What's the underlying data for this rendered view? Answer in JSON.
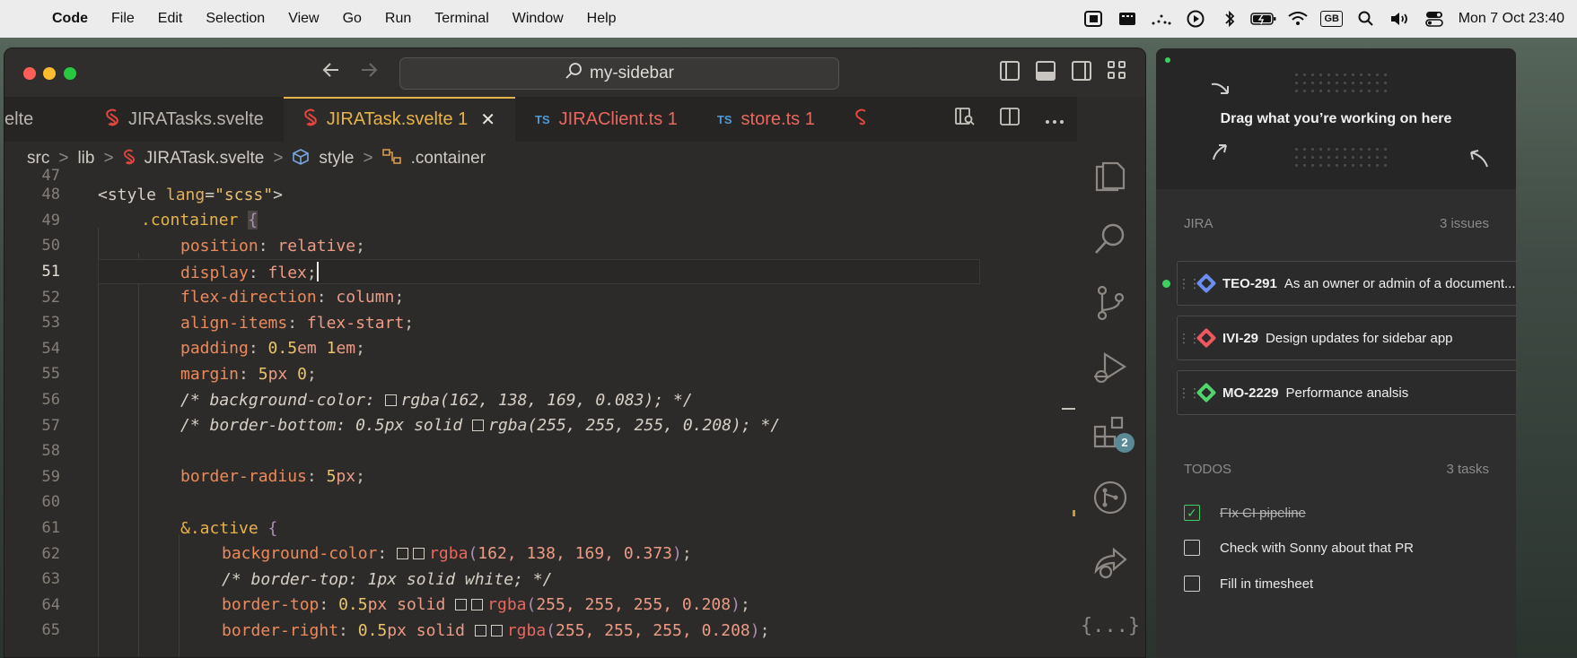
{
  "menubar": {
    "apple": "",
    "app_name": "Code",
    "menus": [
      "File",
      "Edit",
      "Selection",
      "View",
      "Go",
      "Run",
      "Terminal",
      "Window",
      "Help"
    ],
    "status_icons": [
      "stage-manager-icon",
      "display-icon",
      "bars-icon",
      "play-icon",
      "bluetooth-icon",
      "battery-icon",
      "wifi-icon",
      "input-source-icon",
      "spotlight-icon",
      "volume-icon",
      "control-center-icon"
    ],
    "input_source": "GB",
    "clock": "Mon 7 Oct  23:40"
  },
  "titlebar": {
    "search_text": "my-sidebar"
  },
  "tabs": [
    {
      "label": "elte",
      "icon": "svelte-icon",
      "state": "partial"
    },
    {
      "label": "JIRATasks.svelte",
      "icon": "svelte-icon",
      "state": "normal"
    },
    {
      "label": "JIRATask.svelte",
      "problems": "1",
      "icon": "svelte-icon",
      "state": "active"
    },
    {
      "label": "JIRAClient.ts",
      "problems": "1",
      "icon": "ts-icon",
      "state": "error"
    },
    {
      "label": "store.ts",
      "problems": "1",
      "icon": "ts-icon",
      "state": "error"
    }
  ],
  "tab_icon_text": {
    "ts": "TS",
    "svelte": "S"
  },
  "breadcrumb": {
    "items": [
      "src",
      "lib",
      "JIRATask.svelte",
      "style",
      ".container"
    ],
    "separator": ">"
  },
  "editor": {
    "current_line": "51",
    "line_numbers": [
      "47",
      "48",
      "49",
      "50",
      "51",
      "52",
      "53",
      "54",
      "55",
      "56",
      "57",
      "58",
      "59",
      "60",
      "61",
      "62",
      "63",
      "64",
      "65"
    ],
    "lines": {
      "l48": {
        "open": "<style ",
        "attr": "lang",
        "eq": "=",
        "str": "\"scss\"",
        "close": ">"
      },
      "l49": {
        "selector": ".container",
        "brace": "{"
      },
      "l50": {
        "prop": "position",
        "value": "relative"
      },
      "l51": {
        "prop": "display",
        "value": "flex"
      },
      "l52": {
        "prop": "flex-direction",
        "value": "column"
      },
      "l53": {
        "prop": "align-items",
        "value": "flex-start"
      },
      "l54": {
        "prop": "padding",
        "num1": "0.5",
        "unit1": "em",
        "num2": "1",
        "unit2": "em"
      },
      "l55": {
        "prop": "margin",
        "num1": "5",
        "unit1": "px",
        "num2": "0"
      },
      "l56": {
        "pre": "/* background-color: ",
        "post": "rgba(162, 138, 169, 0.083); */"
      },
      "l57": {
        "pre": "/* border-bottom: 0.5px solid ",
        "post": "rgba(255, 255, 255, 0.208); */"
      },
      "l59": {
        "prop": "border-radius",
        "num1": "5",
        "unit1": "px"
      },
      "l61": {
        "amp": "&",
        "selector": ".active",
        "brace": "{"
      },
      "l62": {
        "prop": "background-color",
        "fn": "rgba",
        "args": "162, 138, 169, 0.373"
      },
      "l63": {
        "comment": "/* border-top: 1px solid white; */"
      },
      "l64": {
        "prop": "border-top",
        "num1": "0.5",
        "unit1": "px",
        "word": "solid",
        "fn": "rgba",
        "args": "255, 255, 255, 0.208"
      },
      "l65": {
        "prop": "border-right",
        "num1": "0.5",
        "unit1": "px",
        "word": "solid",
        "fn": "rgba",
        "args": "255, 255, 255, 0.208"
      }
    }
  },
  "activity_bar": {
    "items": [
      "explorer-icon",
      "search-icon",
      "source-control-icon",
      "run-debug-icon",
      "extensions-icon",
      "git-graph-icon",
      "remote-share-icon",
      "json-icon"
    ],
    "extensions_badge": "2",
    "json_glyph": "{...}"
  },
  "sidebar_app": {
    "dropzone_text": "Drag what you’re working on here",
    "jira": {
      "title": "JIRA",
      "count": "3 issues",
      "issues": [
        {
          "key": "TEO-291",
          "summary": "As an owner or admin of a document...",
          "color": "#6b8ef5",
          "active": true
        },
        {
          "key": "IVI-29",
          "summary": "Design updates for sidebar app",
          "color": "#f0585f",
          "active": false
        },
        {
          "key": "MO-2229",
          "summary": "Performance analsis",
          "color": "#4fd56b",
          "active": false
        }
      ]
    },
    "todos": {
      "title": "TODOS",
      "count": "3 tasks",
      "items": [
        {
          "text": "FIx CI pipeline",
          "done": true
        },
        {
          "text": "Check with Sonny about that PR",
          "done": false
        },
        {
          "text": "Fill in timesheet",
          "done": false
        }
      ]
    },
    "checkmark": "✓"
  },
  "colors": {
    "accent": "#e6b34a",
    "error": "#e8685e",
    "status_green": "#3cd060"
  }
}
